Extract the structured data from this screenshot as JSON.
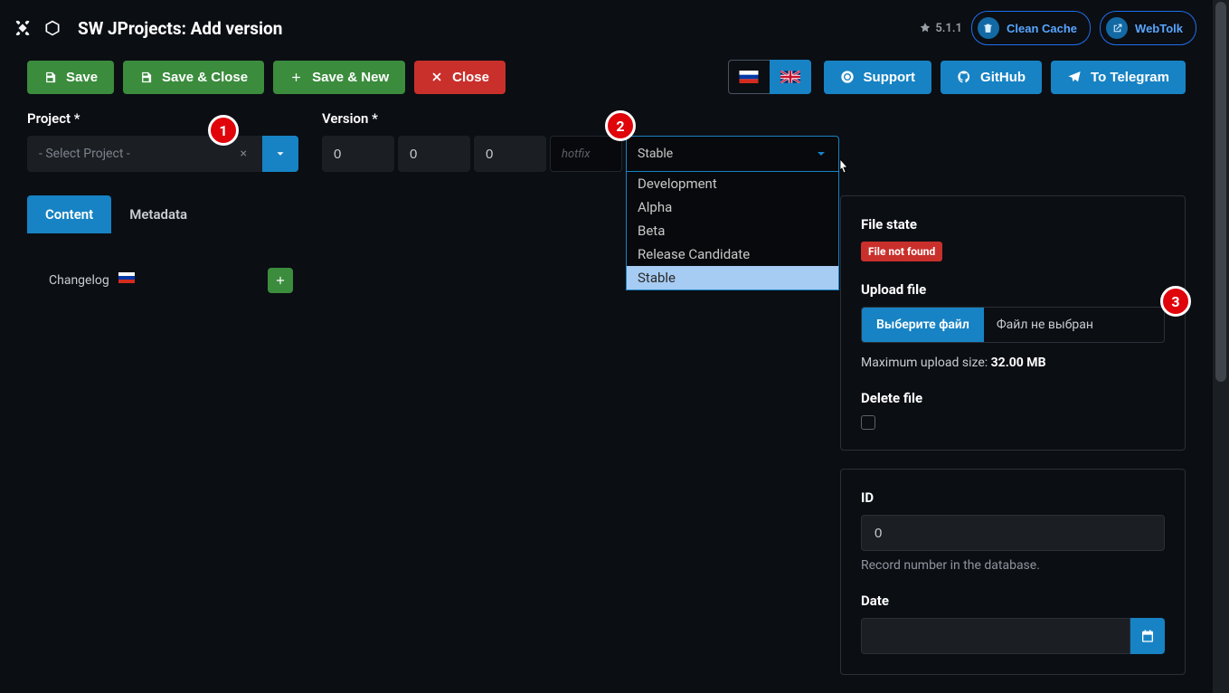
{
  "header": {
    "page_title": "SW JProjects: Add version",
    "joomla_version": "5.1.1",
    "clean_cache": "Clean Cache",
    "webtolk": "WebTolk"
  },
  "toolbar": {
    "save": "Save",
    "save_close": "Save & Close",
    "save_new": "Save & New",
    "close": "Close",
    "support": "Support",
    "github": "GitHub",
    "telegram": "To Telegram"
  },
  "fields": {
    "project_label": "Project *",
    "project_placeholder": "- Select Project -",
    "version_label": "Version  *",
    "v_major": "0",
    "v_minor": "0",
    "v_patch": "0",
    "hotfix_placeholder": "hotfix",
    "stage_selected": "Stable",
    "stage_options": [
      "Development",
      "Alpha",
      "Beta",
      "Release Candidate",
      "Stable"
    ]
  },
  "tabs": {
    "content": "Content",
    "metadata": "Metadata"
  },
  "changelog": {
    "label": "Changelog"
  },
  "sidebar": {
    "file_state_label": "File state",
    "file_state_badge": "File not found",
    "upload_label": "Upload file",
    "choose_file": "Выберите файл",
    "no_file": "Файл не выбран",
    "max_upload_prefix": "Maximum upload size: ",
    "max_upload_value": "32.00 MB",
    "delete_file": "Delete file",
    "id_label": "ID",
    "id_value": "0",
    "id_hint": "Record number in the database.",
    "date_label": "Date"
  },
  "badges": {
    "b1": "1",
    "b2": "2",
    "b3": "3"
  }
}
